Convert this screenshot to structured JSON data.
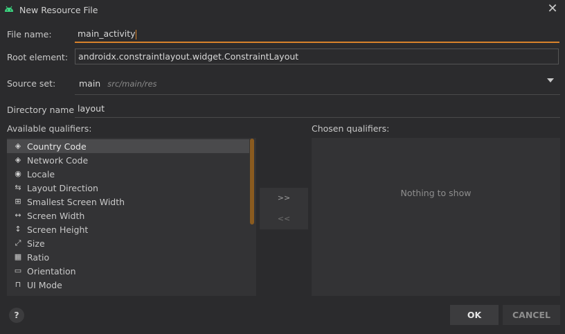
{
  "window": {
    "title": "New Resource File",
    "close_icon": "close-icon",
    "app_icon": "android-icon"
  },
  "form": {
    "file_name": {
      "label": "File name:",
      "value": "main_activity"
    },
    "root_element": {
      "label": "Root element:",
      "value": "androidx.constraintlayout.widget.ConstraintLayout"
    },
    "source_set": {
      "label": "Source set:",
      "value": "main",
      "hint": "src/main/res"
    },
    "directory_name": {
      "label": "Directory name:",
      "value": "layout"
    }
  },
  "qualifiers": {
    "available_label": "Available qualifiers:",
    "chosen_label": "Chosen qualifiers:",
    "items": [
      {
        "label": "Country Code",
        "icon": "country-code-icon",
        "glyph": "◈"
      },
      {
        "label": "Network Code",
        "icon": "network-code-icon",
        "glyph": "◈"
      },
      {
        "label": "Locale",
        "icon": "globe-icon",
        "glyph": "◉"
      },
      {
        "label": "Layout Direction",
        "icon": "layout-direction-icon",
        "glyph": "⇆"
      },
      {
        "label": "Smallest Screen Width",
        "icon": "smallest-width-icon",
        "glyph": "⊞"
      },
      {
        "label": "Screen Width",
        "icon": "screen-width-icon",
        "glyph": "↔"
      },
      {
        "label": "Screen Height",
        "icon": "screen-height-icon",
        "glyph": "↕"
      },
      {
        "label": "Size",
        "icon": "size-icon",
        "glyph": "⤢"
      },
      {
        "label": "Ratio",
        "icon": "ratio-icon",
        "glyph": "▦"
      },
      {
        "label": "Orientation",
        "icon": "orientation-icon",
        "glyph": "▭"
      },
      {
        "label": "UI Mode",
        "icon": "ui-mode-icon",
        "glyph": "⊓"
      }
    ],
    "empty_text": "Nothing to show",
    "add_label": ">>",
    "remove_label": "<<"
  },
  "buttons": {
    "help": "?",
    "ok": "OK",
    "cancel": "CANCEL"
  },
  "colors": {
    "accent": "#d9822b",
    "background": "#2b2b2d",
    "panel": "#333335"
  }
}
